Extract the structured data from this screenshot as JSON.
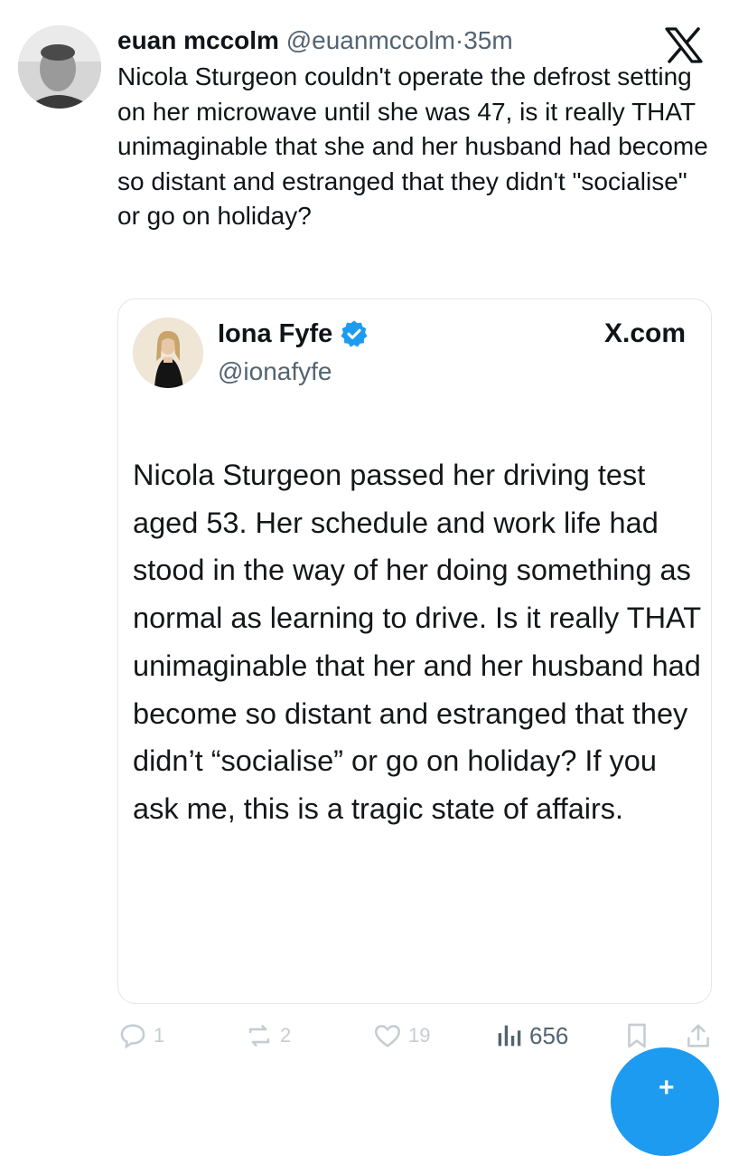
{
  "tweet": {
    "author_name": "euan mccolm",
    "author_handle": "@euanmccolm",
    "separator": "·",
    "time": "35m",
    "text": "Nicola Sturgeon couldn't operate the defrost setting on her microwave until she was 47, is it really THAT unimaginable that she and her husband had become so distant and estranged that they didn't \"socialise\" or go on holiday?"
  },
  "quoted": {
    "author_name": "Iona Fyfe",
    "author_handle": "@ionafyfe",
    "source": "X.com",
    "text": "Nicola Sturgeon passed her driving test aged 53. Her schedule and work life had stood in the way of her doing something as normal as learning to drive. Is it really THAT unimaginable that her and her husband had become so distant and estranged that they didn’t “socialise” or go on holiday? If you ask me, this is a tragic state of affairs."
  },
  "actions": {
    "replies": "1",
    "reposts": "2",
    "likes": "19",
    "views": "656"
  },
  "icons": {
    "brand": "x-logo-icon",
    "verified": "verified-badge-icon",
    "reply": "reply-icon",
    "repost": "repost-icon",
    "like": "heart-icon",
    "views": "views-icon",
    "bookmark": "bookmark-icon",
    "share": "share-icon",
    "compose": "compose-plus-icon"
  },
  "colors": {
    "accent": "#1d9bf0",
    "text": "#0f1419",
    "muted": "#536471"
  }
}
